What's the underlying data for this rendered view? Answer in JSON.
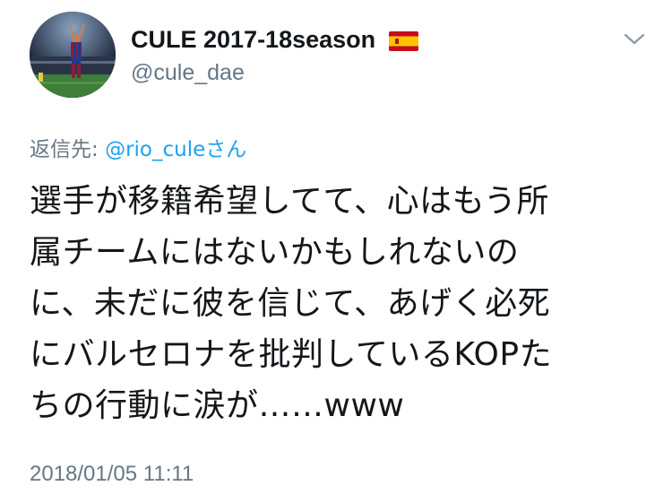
{
  "user": {
    "display_name": "CULE 2017-18season",
    "flag": "spain-flag",
    "handle": "@cule_dae"
  },
  "menu": {
    "icon": "chevron-down-icon"
  },
  "reply": {
    "prefix": "返信先: ",
    "user": "@rio_cule",
    "suffix": "さん"
  },
  "tweet": {
    "lines": [
      "選手が移籍希望してて、心はもう所",
      "属チームにはないかもしれないの",
      "に、未だに彼を信じて、あげく必死",
      "にバルセロナを批判しているKOPた",
      "ちの行動に涙が……www"
    ]
  },
  "timestamp": "2018/01/05 11:11",
  "colors": {
    "text": "#14171a",
    "secondary": "#657786",
    "link": "#1da1f2"
  }
}
